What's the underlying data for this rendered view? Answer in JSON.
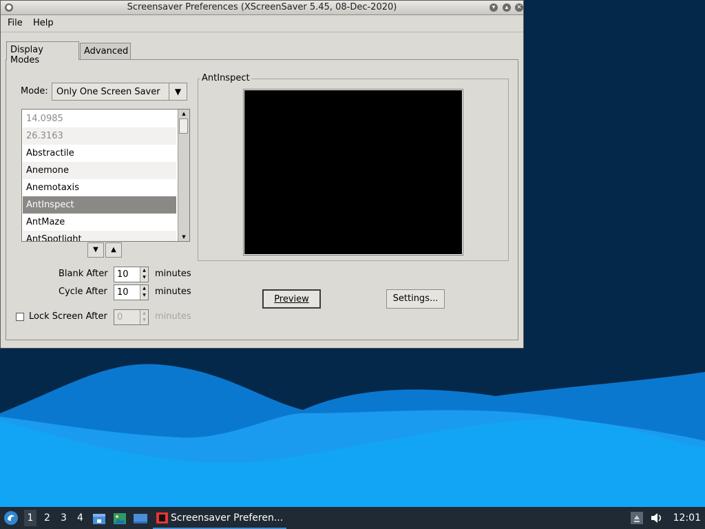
{
  "window": {
    "title": "Screensaver Preferences  (XScreenSaver 5.45, 08-Dec-2020)"
  },
  "menu": {
    "file": "File",
    "help": "Help"
  },
  "tabs": [
    {
      "label": "Display Modes",
      "active": true
    },
    {
      "label": "Advanced",
      "active": false
    }
  ],
  "mode": {
    "label": "Mode:",
    "value": "Only One Screen Saver"
  },
  "savers": [
    {
      "name": "14.0985",
      "dim": true
    },
    {
      "name": "26.3163",
      "dim": true
    },
    {
      "name": "Abstractile"
    },
    {
      "name": "Anemone"
    },
    {
      "name": "Anemotaxis"
    },
    {
      "name": "AntInspect",
      "selected": true
    },
    {
      "name": "AntMaze"
    },
    {
      "name": "AntSpotlight"
    }
  ],
  "fields": {
    "blank_label": "Blank After",
    "blank_value": "10",
    "cycle_label": "Cycle After",
    "cycle_value": "10",
    "lock_label": "Lock Screen After",
    "lock_value": "0",
    "unit": "minutes"
  },
  "preview": {
    "legend": "AntInspect",
    "button": "Preview",
    "settings": "Settings..."
  },
  "taskbar": {
    "workspaces": [
      "1",
      "2",
      "3",
      "4"
    ],
    "task_label": "Screensaver Preferen...",
    "clock": "12:01"
  },
  "colors": {
    "accent": "#3b8fd6",
    "selection": "#8a8986",
    "wallpaper_dark": "#03284a",
    "wallpaper_light": "#1a9bf0"
  },
  "icons": [
    "menu-start-icon",
    "file-manager-icon",
    "image-viewer-icon",
    "desktop-icon",
    "screensaver-app-icon",
    "keyboard-layout-icon",
    "volume-icon"
  ]
}
